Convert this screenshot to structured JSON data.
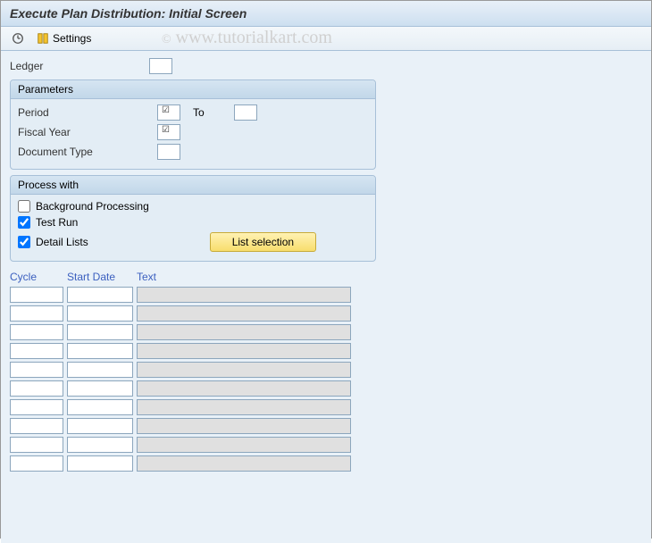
{
  "title": "Execute Plan Distribution: Initial Screen",
  "toolbar": {
    "settings_label": "Settings"
  },
  "ledger": {
    "label": "Ledger",
    "value": ""
  },
  "parameters": {
    "group_title": "Parameters",
    "period": {
      "label": "Period",
      "value": "",
      "required": true
    },
    "to": {
      "label": "To",
      "value": ""
    },
    "fiscal_year": {
      "label": "Fiscal Year",
      "value": "",
      "required": true
    },
    "document_type": {
      "label": "Document Type",
      "value": ""
    }
  },
  "process": {
    "group_title": "Process with",
    "background_processing": {
      "label": "Background Processing",
      "checked": false
    },
    "test_run": {
      "label": "Test Run",
      "checked": true
    },
    "detail_lists": {
      "label": "Detail Lists",
      "checked": true
    },
    "list_selection_label": "List selection"
  },
  "table": {
    "headers": {
      "cycle": "Cycle",
      "start_date": "Start Date",
      "text": "Text"
    },
    "rows": [
      {
        "cycle": "",
        "start_date": "",
        "text": ""
      },
      {
        "cycle": "",
        "start_date": "",
        "text": ""
      },
      {
        "cycle": "",
        "start_date": "",
        "text": ""
      },
      {
        "cycle": "",
        "start_date": "",
        "text": ""
      },
      {
        "cycle": "",
        "start_date": "",
        "text": ""
      },
      {
        "cycle": "",
        "start_date": "",
        "text": ""
      },
      {
        "cycle": "",
        "start_date": "",
        "text": ""
      },
      {
        "cycle": "",
        "start_date": "",
        "text": ""
      },
      {
        "cycle": "",
        "start_date": "",
        "text": ""
      },
      {
        "cycle": "",
        "start_date": "",
        "text": ""
      }
    ]
  },
  "watermark": "www.tutorialkart.com"
}
